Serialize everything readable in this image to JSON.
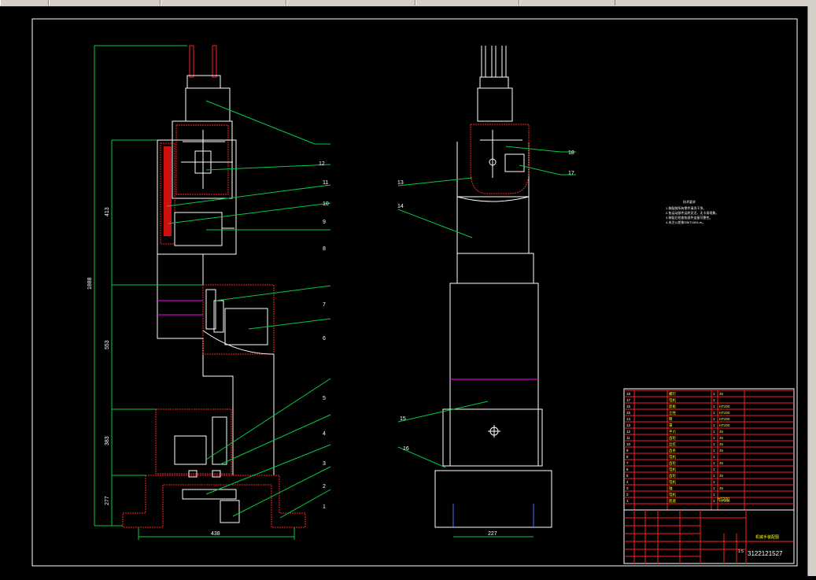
{
  "toolbar": {
    "tabs": [
      "",
      "",
      "",
      "",
      "",
      ""
    ]
  },
  "drawing": {
    "callouts": [
      "1",
      "2",
      "3",
      "4",
      "5",
      "6",
      "7",
      "8",
      "9",
      "10",
      "11",
      "12"
    ],
    "side_callouts": [
      "13",
      "14",
      "15",
      "16",
      "17",
      "18"
    ],
    "dims_left": {
      "total": "1888",
      "d1": "413",
      "d2": "553",
      "d3": "383",
      "d4": "277",
      "base_width": "438"
    },
    "dims_right": {
      "base_width": "227"
    },
    "notes_title": "技术要求",
    "notes": [
      "1.装配前所有零件清洗干净。",
      "2.各运动部件运转灵活，无卡滞现象。",
      "3.装配后检查各部件连接可靠性。",
      "4.未注公差按GB/T1804-m。"
    ]
  },
  "title_block": {
    "drawing_number": "3122121527",
    "title": "机械手装配图",
    "material": "HT200",
    "scale": "1:5",
    "parts": [
      {
        "no": "18",
        "name": "螺钉",
        "qty": "1",
        "mat": "45"
      },
      {
        "no": "17",
        "name": "电机",
        "qty": "1",
        "mat": ""
      },
      {
        "no": "16",
        "name": "底板",
        "qty": "1",
        "mat": "HT200"
      },
      {
        "no": "15",
        "name": "立柱",
        "qty": "1",
        "mat": "HT200"
      },
      {
        "no": "14",
        "name": "臂",
        "qty": "1",
        "mat": "HT200"
      },
      {
        "no": "13",
        "name": "罩",
        "qty": "1",
        "mat": "HT200"
      },
      {
        "no": "12",
        "name": "手爪",
        "qty": "1",
        "mat": "45"
      },
      {
        "no": "11",
        "name": "齿轮",
        "qty": "1",
        "mat": "45"
      },
      {
        "no": "10",
        "name": "丝杠",
        "qty": "1",
        "mat": "45"
      },
      {
        "no": "9",
        "name": "齿条",
        "qty": "1",
        "mat": "45"
      },
      {
        "no": "8",
        "name": "电机",
        "qty": "1",
        "mat": ""
      },
      {
        "no": "7",
        "name": "齿轮",
        "qty": "1",
        "mat": "45"
      },
      {
        "no": "6",
        "name": "电机",
        "qty": "1",
        "mat": ""
      },
      {
        "no": "5",
        "name": "齿轮",
        "qty": "1",
        "mat": "45"
      },
      {
        "no": "4",
        "name": "电机",
        "qty": "1",
        "mat": ""
      },
      {
        "no": "3",
        "name": "轴",
        "qty": "1",
        "mat": "45"
      },
      {
        "no": "2",
        "name": "电机",
        "qty": "1",
        "mat": ""
      },
      {
        "no": "1",
        "name": "底座",
        "qty": "1",
        "mat": "HT200"
      }
    ]
  },
  "colors": {
    "line": "#ffffff",
    "leader": "#00cc44",
    "hatch": "#ff2020",
    "dim": "#00cc44",
    "center": "#ff00ff",
    "text": "#ffff00"
  }
}
